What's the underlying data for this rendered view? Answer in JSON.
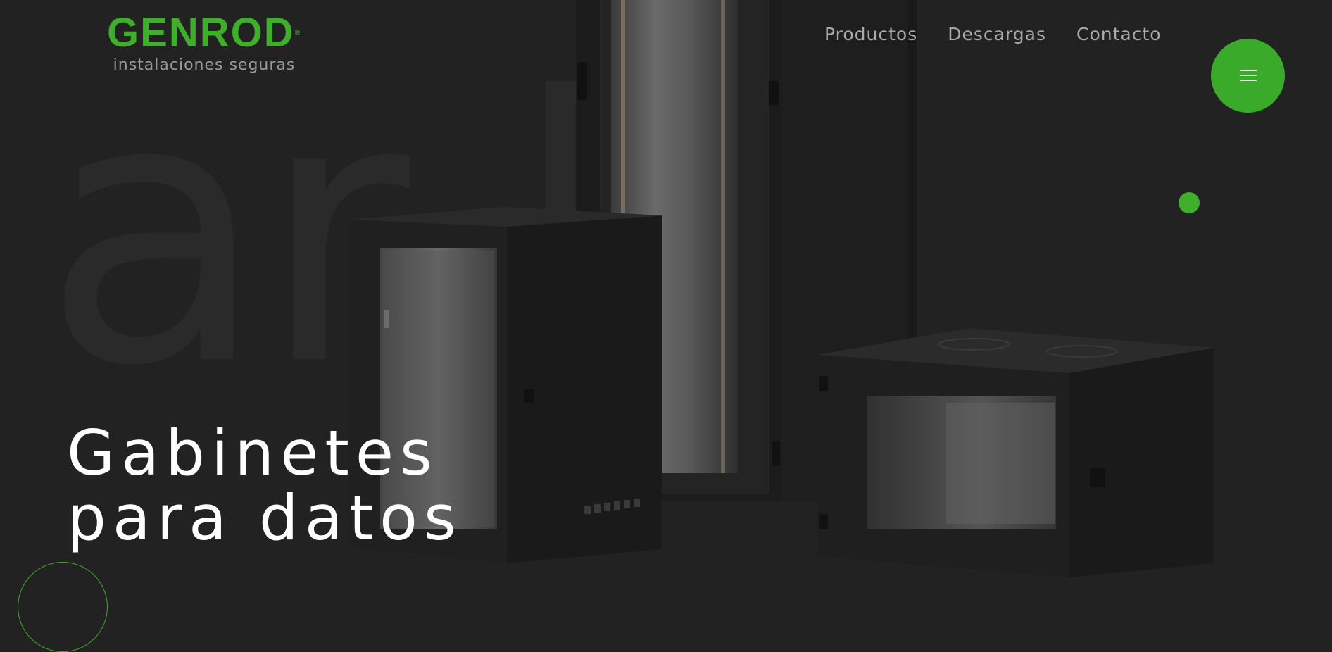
{
  "background_word": "ar ks",
  "logo": {
    "name": "GENROD",
    "registered_mark": "®",
    "tagline": "instalaciones seguras"
  },
  "nav": {
    "items": [
      {
        "label": "Productos"
      },
      {
        "label": "Descargas"
      },
      {
        "label": "Contacto"
      }
    ]
  },
  "hero": {
    "title_line1": "Gabinetes",
    "title_line2": "para datos"
  },
  "icons": {
    "menu": "hamburger-menu-icon"
  },
  "colors": {
    "brand_green": "#3fae2a",
    "background": "#222222",
    "nav_text": "#a9a9a9",
    "hero_text": "#ffffff"
  }
}
